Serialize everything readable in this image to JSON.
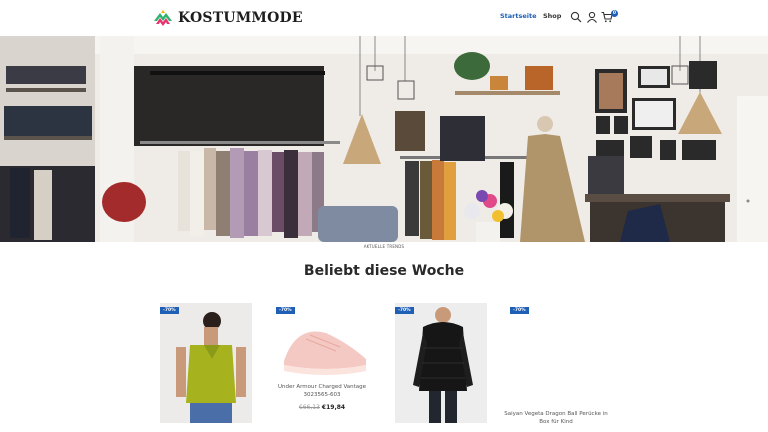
{
  "brand": {
    "name": "KOSTUMMODE"
  },
  "nav": {
    "items": [
      "Startseite",
      "Shop"
    ],
    "active": "Startseite"
  },
  "icons": {
    "search": "search-icon",
    "account": "user-icon",
    "cart": "cart-icon"
  },
  "cart": {
    "count": "0"
  },
  "hero": {
    "caption": "AKTUELLE TRENDS"
  },
  "section": {
    "title": "Beliebt diese Woche"
  },
  "products": [
    {
      "badge": "-70%",
      "name": "",
      "old_price": "",
      "new_price": ""
    },
    {
      "badge": "-70%",
      "name": "Under Armour Charged Vantage 3023565-603",
      "old_price": "€66,13",
      "new_price": "€19,84"
    },
    {
      "badge": "-70%",
      "name": "",
      "old_price": "",
      "new_price": ""
    },
    {
      "badge": "-70%",
      "name": "Saiyan Vegeta Dragon Ball Perücke in Box für Kind",
      "old_price": "",
      "new_price": ""
    }
  ],
  "colors": {
    "accent": "#1f5fb5",
    "logo_green": "#2db36b",
    "logo_pink": "#e6336f",
    "logo_yellow": "#f4b400"
  }
}
